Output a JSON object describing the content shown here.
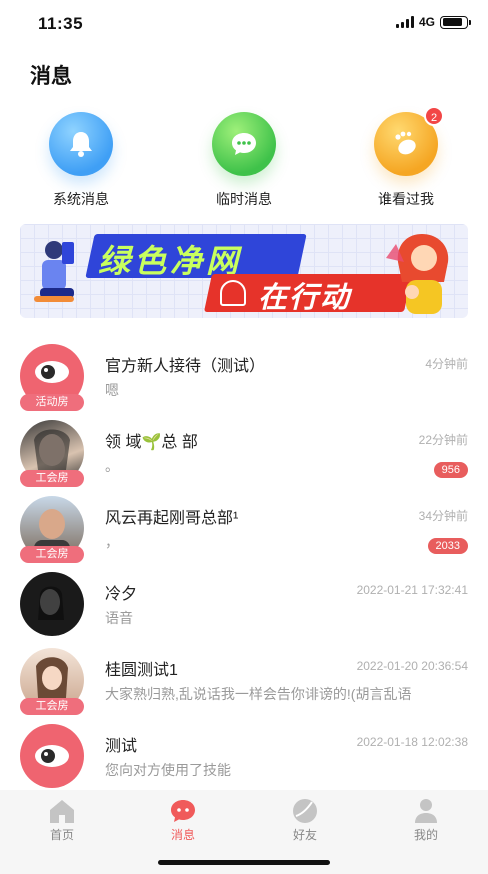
{
  "status_bar": {
    "time": "11:35",
    "network": "4G",
    "battery_level": 0.85
  },
  "page": {
    "title": "消息"
  },
  "quick_actions": [
    {
      "label": "系统消息",
      "icon": "bell-icon",
      "color": "#3f9ff5"
    },
    {
      "label": "临时消息",
      "icon": "chat-bubble-icon",
      "color": "#3fc24a"
    },
    {
      "label": "谁看过我",
      "icon": "footprint-icon",
      "color": "#f5a623",
      "badge": "2"
    }
  ],
  "banner": {
    "line1": "绿色净网",
    "line2": "在行动"
  },
  "conversations": [
    {
      "name": "官方新人接待（测试）",
      "message": "嗯",
      "time": "4分钟前",
      "tag": "活动房",
      "avatar": "eye-logo",
      "unread": ""
    },
    {
      "name": "领 域🌱总 部",
      "message": "。",
      "time": "22分钟前",
      "tag": "工会房",
      "avatar": "photo-woman",
      "unread": "956"
    },
    {
      "name": "风云再起刚哥总部¹",
      "message": "，",
      "time": "34分钟前",
      "tag": "工会房",
      "avatar": "photo-man",
      "unread": "2033"
    },
    {
      "name": "冷夕",
      "message": "语音",
      "time": "2022-01-21 17:32:41",
      "tag": "",
      "avatar": "photo-dark",
      "unread": ""
    },
    {
      "name": "桂圆测试1",
      "message": "大家熟归熟,乱说话我一样会告你诽谤的!(胡言乱语",
      "time": "2022-01-20 20:36:54",
      "tag": "工会房",
      "avatar": "photo-girl",
      "unread": ""
    },
    {
      "name": "测试",
      "message": "您向对方使用了技能",
      "time": "2022-01-18 12:02:38",
      "tag": "",
      "avatar": "eye-logo",
      "unread": ""
    }
  ],
  "tabbar": {
    "active_color": "#f05a5a",
    "items": [
      {
        "label": "首页",
        "icon": "home-icon"
      },
      {
        "label": "消息",
        "icon": "message-icon"
      },
      {
        "label": "好友",
        "icon": "friends-icon"
      },
      {
        "label": "我的",
        "icon": "profile-icon"
      }
    ]
  }
}
